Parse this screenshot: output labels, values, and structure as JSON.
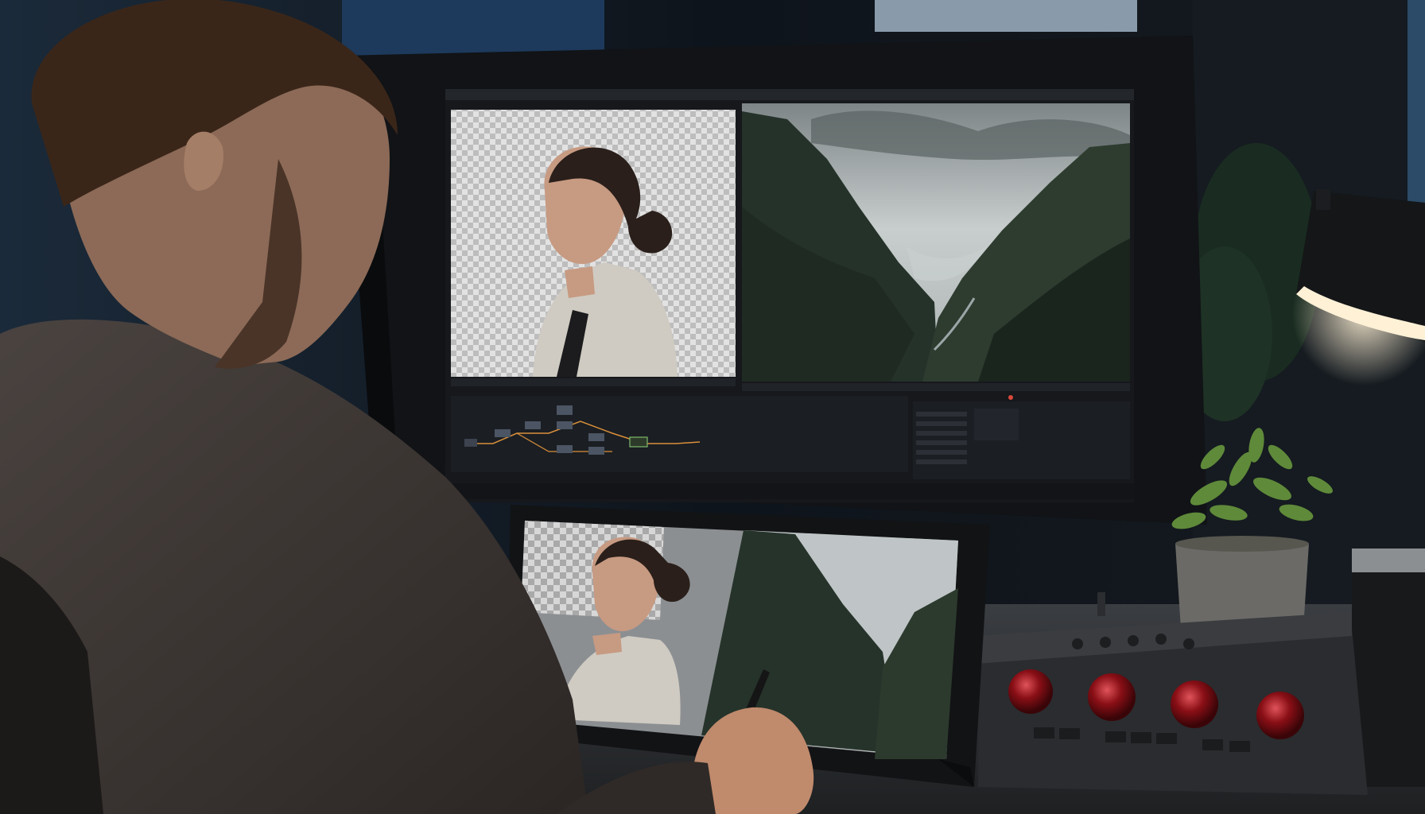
{
  "scene": {
    "palette": {
      "room_dark": "#0b0e12",
      "window_blue": "#1d3a5c",
      "window_light": "#9fb3c4",
      "monitor_body": "#111316",
      "ui_panel": "#1b1e23",
      "ui_node_wire": "#d9903a",
      "ui_node_selected": "#7fb86a",
      "checker_light": "#e2e2e2",
      "checker_dark": "#bdbdbd",
      "sky": "#bfc5c6",
      "mountain_dark": "#1e2a22",
      "mountain_mid": "#3a4a3c",
      "mist": "#c9d0d0",
      "coat": "#cfcbc2",
      "skin": "#c79a82",
      "hair": "#2a1f1a",
      "sweater": "#3c3633",
      "trackball_red": "#8a0f16",
      "lamp_glow": "#fff1d6",
      "plant_green": "#5f8a3a"
    },
    "icons": {
      "lamp": "desk-lamp-icon",
      "plant": "potted-plant-icon",
      "panel": "color-grading-panel-icon",
      "stylus": "stylus-pen-icon"
    }
  }
}
